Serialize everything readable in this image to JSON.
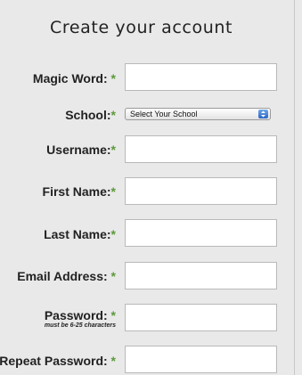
{
  "form": {
    "title": "Create your account",
    "required_marker": "*",
    "fields": [
      {
        "label": "Magic Word:",
        "value": "",
        "type": "text"
      },
      {
        "label": "School:",
        "selected": "Select Your School",
        "type": "select"
      },
      {
        "label": "Username:",
        "value": "",
        "type": "text"
      },
      {
        "label": "First Name:",
        "value": "",
        "type": "text"
      },
      {
        "label": "Last Name:",
        "value": "",
        "type": "text"
      },
      {
        "label": "Email Address:",
        "value": "",
        "type": "text"
      },
      {
        "label": "Password:",
        "hint": "must be 6-25 characters",
        "value": "",
        "type": "password"
      },
      {
        "label": "Repeat Password:",
        "value": "",
        "type": "password"
      }
    ]
  },
  "colors": {
    "required_marker": "#5c9a3a",
    "background": "#e9e9e9"
  }
}
